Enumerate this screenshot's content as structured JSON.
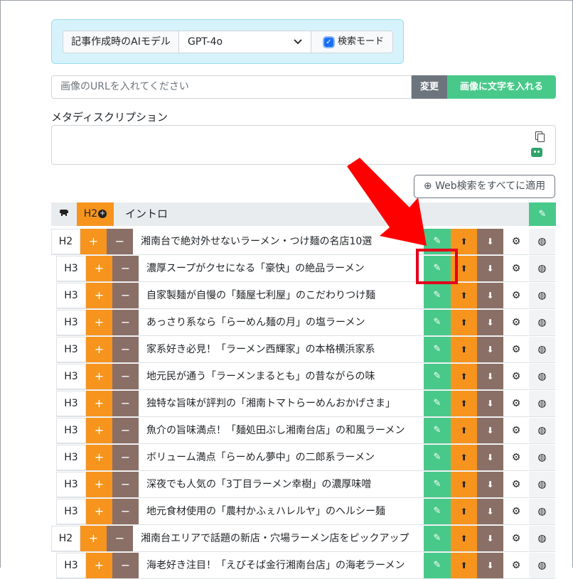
{
  "ai_model": {
    "label": "記事作成時のAIモデル",
    "value": "GPT-4o",
    "search_mode_label": "検索モード",
    "search_mode_checked": true
  },
  "image": {
    "url_placeholder": "画像のURLを入れてください",
    "change_label": "変更",
    "add_text_label": "画像に文字を入れる"
  },
  "meta": {
    "label": "メタディスクリプション"
  },
  "web_search_all_label": "⊕ Web検索をすべてに適用",
  "intro": {
    "level": "H2",
    "text": "イントロ"
  },
  "headings": [
    {
      "level": "H2",
      "text": "湘南台で絶対外せないラーメン・つけ麺の名店10選"
    },
    {
      "level": "H3",
      "text": "濃厚スープがクセになる「豪快」の絶品ラーメン"
    },
    {
      "level": "H3",
      "text": "自家製麺が自慢の「麺屋七利屋」のこだわりつけ麺"
    },
    {
      "level": "H3",
      "text": "あっさり系なら「らーめん麺の月」の塩ラーメン"
    },
    {
      "level": "H3",
      "text": "家系好き必見！「ラーメン西輝家」の本格横浜家系"
    },
    {
      "level": "H3",
      "text": "地元民が通う「ラーメンまるとも」の昔ながらの味"
    },
    {
      "level": "H3",
      "text": "独特な旨味が評判の「湘南トマトらーめんおかげさま」"
    },
    {
      "level": "H3",
      "text": "魚介の旨味満点！「麺処田ぶし湘南台店」の和風ラーメン"
    },
    {
      "level": "H3",
      "text": "ボリューム満点「らーめん夢中」の二郎系ラーメン"
    },
    {
      "level": "H3",
      "text": "深夜でも人気の「3丁目ラーメン幸樹」の濃厚味噌"
    },
    {
      "level": "H3",
      "text": "地元食材使用の「農村かふぇハレルヤ」のヘルシー麺"
    },
    {
      "level": "H2",
      "text": "湘南台エリアで話題の新店・穴場ラーメン店をピックアップ"
    },
    {
      "level": "H3",
      "text": "海老好き注目！「えびそば金行湘南台店」の海老ラーメン"
    }
  ],
  "buttons": {
    "plus": "+",
    "minus": "−",
    "edit_icon": "✎",
    "up_icon": "⬆",
    "down_icon": "⬇",
    "gear_icon": "⚙",
    "globe_icon": "◍"
  },
  "colors": {
    "green": "#48c98a",
    "orange": "#f7941d",
    "brown": "#8a6f66",
    "annotation_red": "#e0001a"
  }
}
